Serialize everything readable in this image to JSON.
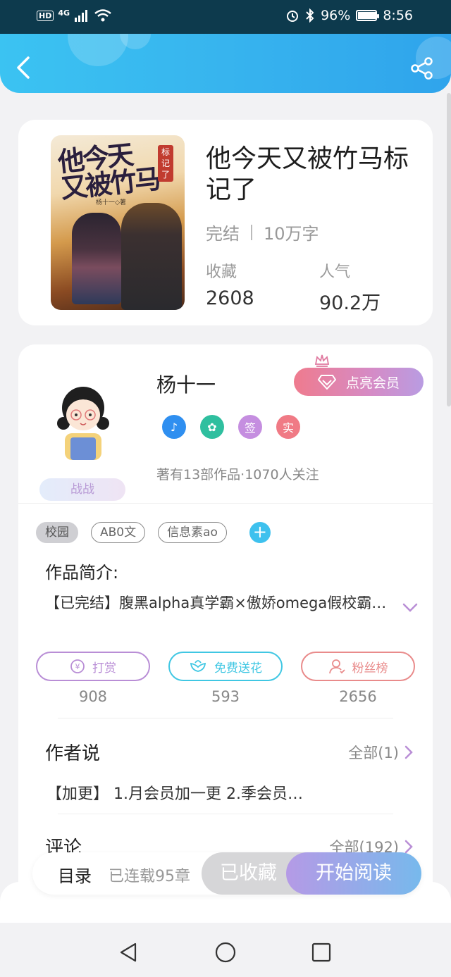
{
  "status_bar": {
    "hd": "HD",
    "network": "4G",
    "battery": "96%",
    "battery_level": 0.96,
    "time": "8:56"
  },
  "book": {
    "title": "他今天又被竹马标记了",
    "status": "完结",
    "word_count": "10万字",
    "collect_label": "收藏",
    "collect_value": "2608",
    "popularity_label": "人气",
    "popularity_value": "90.2万",
    "cover": {
      "title_line1": "他今天",
      "title_line2": "又被竹马",
      "badge": "标记了",
      "author_line": "杨十一◇著"
    }
  },
  "author": {
    "name": "杨十一",
    "nickname_tag": "战战",
    "vip_button": "点亮会员",
    "badges": [
      {
        "icon": "music-note-icon",
        "text": "♪",
        "color": "#2f8ff0"
      },
      {
        "icon": "handshake-icon",
        "text": "✿",
        "color": "#2fbf9f"
      },
      {
        "icon": "sign-icon",
        "text": "签",
        "color": "#c58ee0"
      },
      {
        "icon": "verified-icon",
        "text": "实",
        "color": "#f07a85"
      }
    ],
    "meta": "著有13部作品·1070人关注"
  },
  "tags": [
    "校园",
    "AB0文",
    "信息素ao"
  ],
  "intro": {
    "title": "作品简介:",
    "text": "【已完结】腹黑alpha真学霸×傲娇omega假校霸…"
  },
  "actions": [
    {
      "label": "打赏",
      "count": "908",
      "color": "#b98ed6"
    },
    {
      "label": "免费送花",
      "count": "593",
      "color": "#40c7e3"
    },
    {
      "label": "粉丝榜",
      "count": "2656",
      "color": "#e98b8b"
    }
  ],
  "author_says": {
    "title": "作者说",
    "more": "全部(1)",
    "content": "【加更】 1.月会员加一更 2.季会员…"
  },
  "comments": {
    "title": "评论",
    "more": "全部(192)"
  },
  "read_bar": {
    "toc": "目录",
    "serial": "已连载95章",
    "collected": "已收藏",
    "start": "开始阅读"
  }
}
